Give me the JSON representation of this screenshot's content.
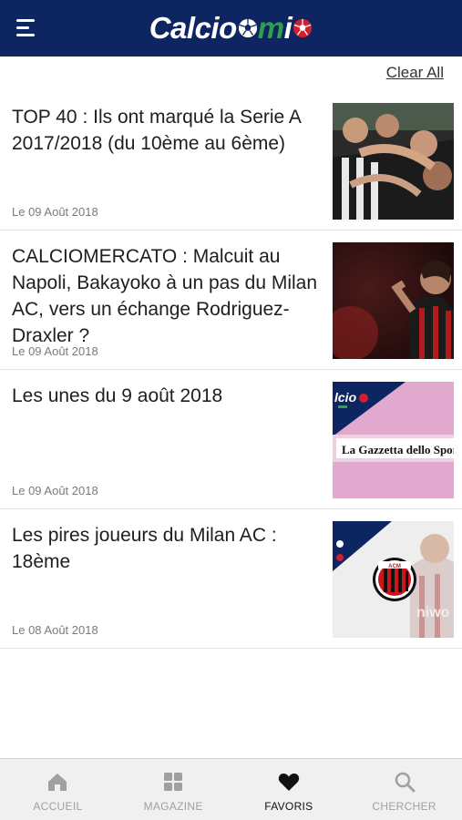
{
  "header": {
    "logo_part1": "Calcio",
    "logo_part2": "m",
    "logo_part3": "i"
  },
  "actions": {
    "clear_all": "Clear All"
  },
  "articles": [
    {
      "title": "TOP 40 : Ils ont marqué la Serie A 2017/2018 (du 10ème au 6ème)",
      "date": "Le 09 Août 2018",
      "thumb": "celebrating-players-photo"
    },
    {
      "title": "CALCIOMERCATO : Malcuit au Napoli, Bakayoko à un pas du Milan AC, vers un échange Rodriguez-Draxler ?",
      "date": "Le 09 Août 2018",
      "thumb": "milan-player-photo"
    },
    {
      "title": "Les unes du 9 août 2018",
      "date": "Le 09 Août 2018",
      "thumb": "gazzetta-front-page",
      "thumb_text": "La Gazzetta dello Sport"
    },
    {
      "title": "Les pires joueurs du Milan AC : 18ème",
      "date": "Le 08 Août 2018",
      "thumb": "ac-milan-crest-photo"
    }
  ],
  "tabs": [
    {
      "label": "ACCUEIL",
      "icon": "home-icon",
      "active": false
    },
    {
      "label": "MAGAZINE",
      "icon": "grid-icon",
      "active": false
    },
    {
      "label": "FAVORIS",
      "icon": "heart-icon",
      "active": true
    },
    {
      "label": "CHERCHER",
      "icon": "search-icon",
      "active": false
    }
  ],
  "colors": {
    "header_bg": "#0d2560",
    "logo_green": "#2ea04a",
    "logo_red": "#d0202e",
    "tab_inactive": "#a0a0a0",
    "tab_active": "#111111"
  }
}
